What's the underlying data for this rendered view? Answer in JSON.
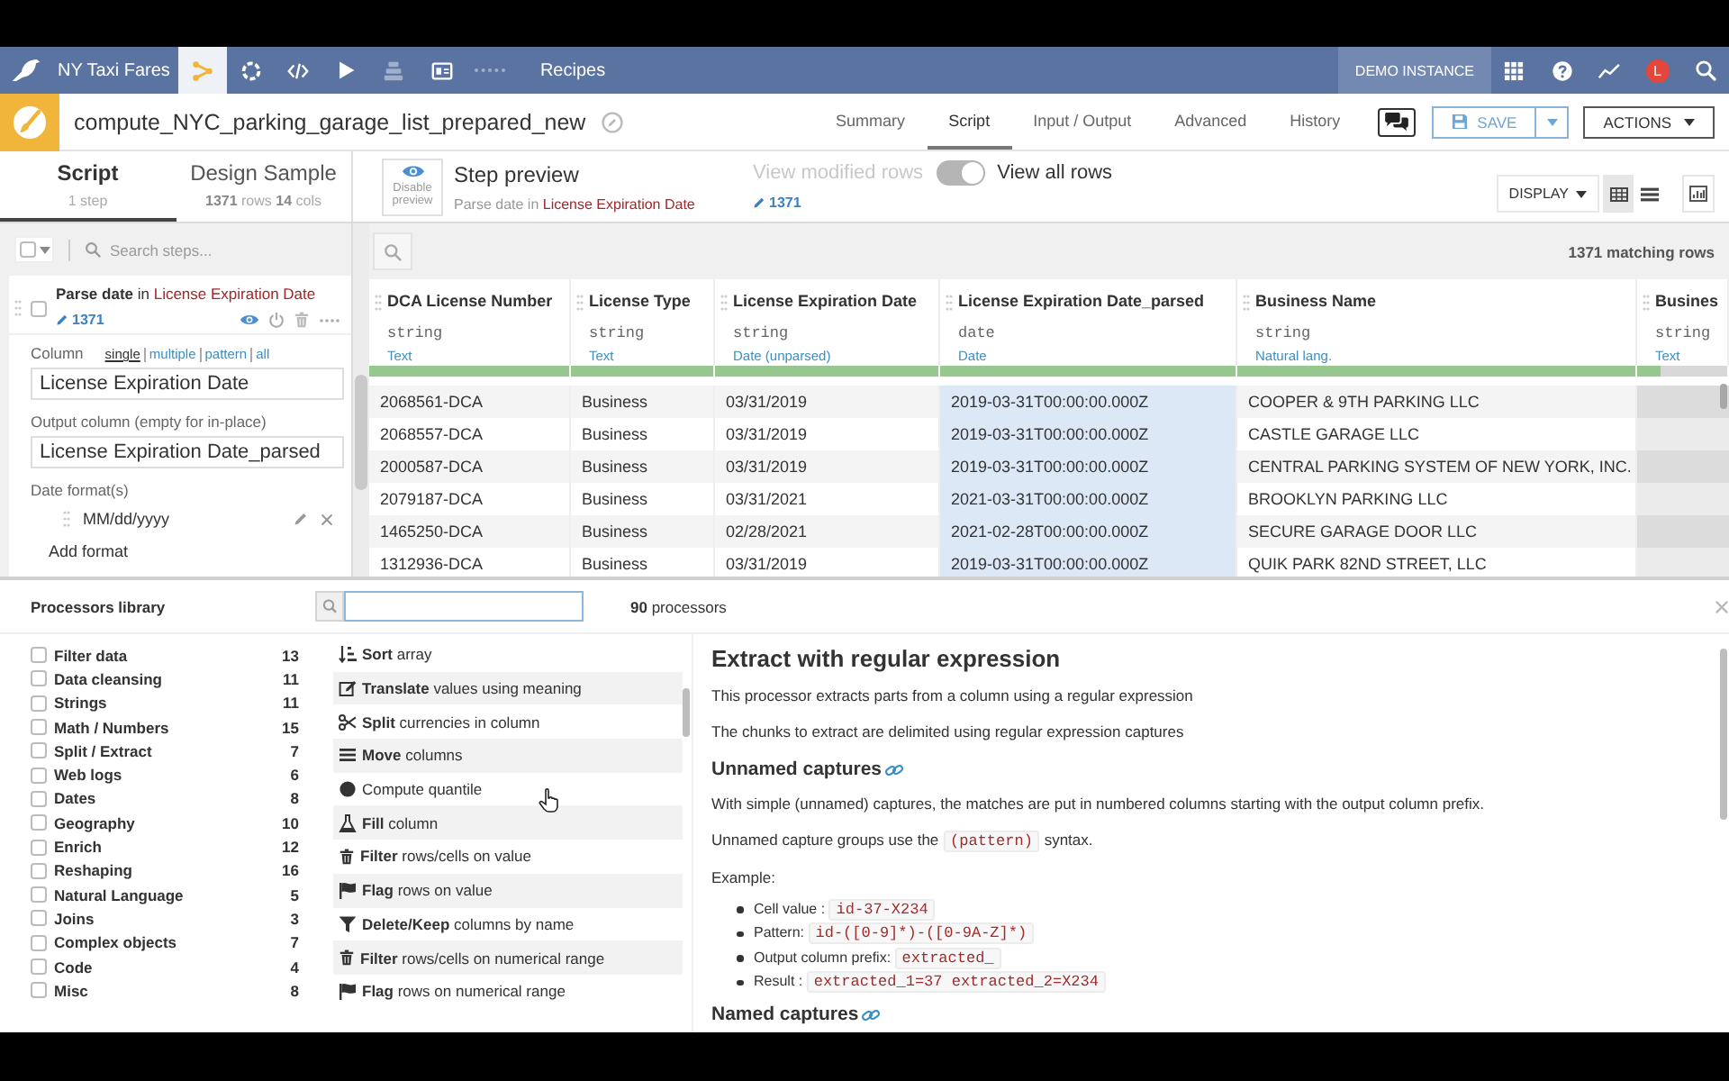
{
  "topnav": {
    "project": "NY Taxi Fares",
    "nav_items": [
      {
        "selected": true,
        "disabled": false
      },
      {
        "selected": false,
        "disabled": false
      },
      {
        "selected": false,
        "disabled": false
      },
      {
        "selected": false,
        "disabled": false
      },
      {
        "selected": false,
        "disabled": true
      },
      {
        "selected": false,
        "disabled": false
      },
      {
        "selected": false,
        "disabled": true
      }
    ],
    "section": "Recipes",
    "instance": "DEMO INSTANCE",
    "avatar": "L"
  },
  "recipe": {
    "name": "compute_NYC_parking_garage_list_prepared_new",
    "tabs": [
      {
        "label": "Summary",
        "selected": false
      },
      {
        "label": "Script",
        "selected": true
      },
      {
        "label": "Input / Output",
        "selected": false
      },
      {
        "label": "Advanced",
        "selected": false
      },
      {
        "label": "History",
        "selected": false
      }
    ],
    "save": "SAVE",
    "actions": "ACTIONS"
  },
  "panel_tabs": [
    {
      "label": "Script",
      "detail": "1 step",
      "selected": true
    },
    {
      "label": "Design Sample",
      "detail": "**1371** rows **14** cols",
      "selected": false
    }
  ],
  "preview": {
    "disable_label": "Disable preview",
    "title": "Step preview",
    "action": "Parse date in",
    "column": "License Expiration Date",
    "modified_label": "View modified rows",
    "view_all": true,
    "all_label": "View all rows",
    "count": "1371",
    "display": "DISPLAY",
    "views": [
      {
        "selected": true
      },
      {
        "selected": false
      }
    ]
  },
  "steps": {
    "search_placeholder": "Search steps...",
    "items": [
      {
        "checked": false,
        "action": "**Parse date** in",
        "column": "License Expiration Date",
        "count": "1371",
        "column_label": "Column",
        "modes": [
          {
            "label": "single",
            "selected": true
          },
          {
            "label": "multiple",
            "selected": false
          },
          {
            "label": "pattern",
            "selected": false
          },
          {
            "label": "all",
            "selected": false
          }
        ],
        "column_value": "License Expiration Date",
        "output_label": "Output column (empty for in-place)",
        "output_value": "License Expiration Date_parsed",
        "formats_label": "Date format(s)",
        "formats": [
          "MM/dd/yyyy"
        ],
        "add_label": "Add format"
      }
    ]
  },
  "table": {
    "matching": "1371 matching rows",
    "columns": [
      {
        "name": "DCA License Number",
        "type": "string",
        "meaning": "Text",
        "level": 1,
        "highlighted": false
      },
      {
        "name": "License Type",
        "type": "string",
        "meaning": "Text",
        "level": 1,
        "highlighted": false
      },
      {
        "name": "License Expiration Date",
        "type": "string",
        "meaning": "Date (unparsed)",
        "level": 1,
        "highlighted": false
      },
      {
        "name": "License Expiration Date_parsed",
        "type": "date",
        "meaning": "Date",
        "level": 1,
        "highlighted": true
      },
      {
        "name": "Business Name",
        "type": "string",
        "meaning": "Natural lang.",
        "level": 1,
        "highlighted": false
      },
      {
        "name": "Busines",
        "type": "string",
        "meaning": "Text",
        "level": 0.25,
        "highlighted": false
      }
    ],
    "rows": [
      [
        "2068561-DCA",
        "Business",
        "03/31/2019",
        "2019-03-31T00:00:00.000Z",
        "COOPER & 9TH PARKING LLC"
      ],
      [
        "2068557-DCA",
        "Business",
        "03/31/2019",
        "2019-03-31T00:00:00.000Z",
        "CASTLE GARAGE LLC"
      ],
      [
        "2000587-DCA",
        "Business",
        "03/31/2019",
        "2019-03-31T00:00:00.000Z",
        "CENTRAL PARKING SYSTEM OF NEW YORK, INC."
      ],
      [
        "2079187-DCA",
        "Business",
        "03/31/2021",
        "2021-03-31T00:00:00.000Z",
        "BROOKLYN PARKING LLC"
      ],
      [
        "1465250-DCA",
        "Business",
        "02/28/2021",
        "2021-02-28T00:00:00.000Z",
        "SECURE GARAGE DOOR LLC"
      ],
      [
        "1312936-DCA",
        "Business",
        "03/31/2019",
        "2019-03-31T00:00:00.000Z",
        "QUIK PARK 82ND STREET, LLC"
      ]
    ]
  },
  "library": {
    "title": "Processors library",
    "count": "**90** processors",
    "categories": [
      {
        "label": "Filter data",
        "count": "13",
        "checked": false
      },
      {
        "label": "Data cleansing",
        "count": "11",
        "checked": false
      },
      {
        "label": "Strings",
        "count": "11",
        "checked": false
      },
      {
        "label": "Math / Numbers",
        "count": "15",
        "checked": false
      },
      {
        "label": "Split / Extract",
        "count": "7",
        "checked": false
      },
      {
        "label": "Web logs",
        "count": "6",
        "checked": false
      },
      {
        "label": "Dates",
        "count": "8",
        "checked": false
      },
      {
        "label": "Geography",
        "count": "10",
        "checked": false
      },
      {
        "label": "Enrich",
        "count": "12",
        "checked": false
      },
      {
        "label": "Reshaping",
        "count": "16",
        "checked": false
      },
      {
        "label": "Natural Language",
        "count": "5",
        "checked": false
      },
      {
        "label": "Joins",
        "count": "3",
        "checked": false
      },
      {
        "label": "Complex objects",
        "count": "7",
        "checked": false
      },
      {
        "label": "Code",
        "count": "4",
        "checked": false
      },
      {
        "label": "Misc",
        "count": "8",
        "checked": false
      }
    ],
    "processors": [
      {
        "text": "**Sort** array"
      },
      {
        "text": "**Translate** values using meaning"
      },
      {
        "text": "**Split** currencies in column"
      },
      {
        "text": "**Move** columns"
      },
      {
        "text": "Compute quantile"
      },
      {
        "text": "**Fill** column"
      },
      {
        "text": "**Filter** rows/cells on value"
      },
      {
        "text": "**Flag** rows on value"
      },
      {
        "text": "**Delete/Keep** columns by name"
      },
      {
        "text": "**Filter** rows/cells on numerical range"
      },
      {
        "text": "**Flag** rows on numerical range"
      }
    ],
    "description": {
      "title": "Extract with regular expression",
      "blocks": [
        {
          "kind": "paragraph",
          "parts": [
            {
              "kind": "text",
              "text": "This processor extracts parts from a column using a regular expression"
            }
          ]
        },
        {
          "kind": "paragraph",
          "parts": [
            {
              "kind": "text",
              "text": "The chunks to extract are delimited using regular expression captures"
            }
          ]
        },
        {
          "kind": "heading",
          "text": "Unnamed captures"
        },
        {
          "kind": "paragraph",
          "parts": [
            {
              "kind": "text",
              "text": "With simple (unnamed) captures, the matches are put in numbered columns starting with the output column prefix."
            }
          ]
        },
        {
          "kind": "paragraph",
          "parts": [
            {
              "kind": "text",
              "text": "Unnamed capture groups use the "
            },
            {
              "kind": "code",
              "text": "(pattern)"
            },
            {
              "kind": "text",
              "text": " syntax."
            }
          ]
        },
        {
          "kind": "paragraph",
          "parts": [
            {
              "kind": "text",
              "text": "Example:"
            }
          ]
        },
        {
          "kind": "bullets",
          "items": [
            {
              "parts": [
                {
                  "kind": "text",
                  "text": "Cell value : "
                },
                {
                  "kind": "code",
                  "text": "id-37-X234"
                }
              ]
            },
            {
              "parts": [
                {
                  "kind": "text",
                  "text": "Pattern: "
                },
                {
                  "kind": "code",
                  "text": "id-([0-9]*)-([0-9A-Z]*)"
                }
              ]
            },
            {
              "parts": [
                {
                  "kind": "text",
                  "text": "Output column prefix: "
                },
                {
                  "kind": "code",
                  "text": "extracted_"
                }
              ]
            },
            {
              "parts": [
                {
                  "kind": "text",
                  "text": "Result : "
                },
                {
                  "kind": "code",
                  "text": "extracted_1=37 extracted_2=X234"
                }
              ]
            }
          ]
        },
        {
          "kind": "heading",
          "text": "Named captures"
        }
      ]
    }
  }
}
